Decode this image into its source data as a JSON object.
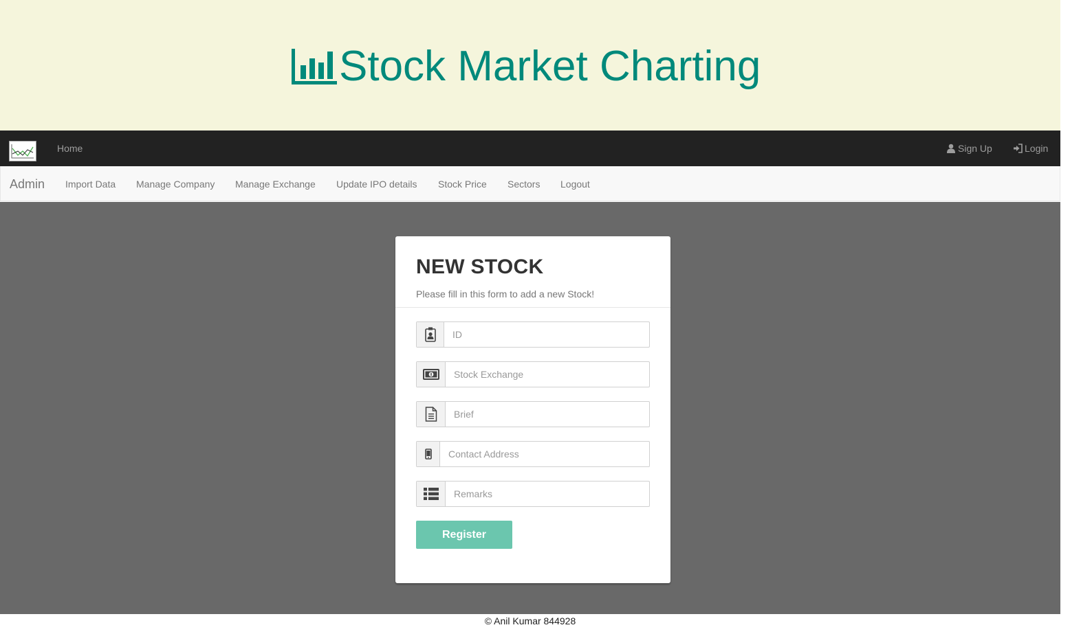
{
  "banner": {
    "title": "Stock Market Charting",
    "icon": "bar-chart-icon",
    "color": "#00897b"
  },
  "topnav": {
    "logo": "stock-chart-logo",
    "home": "Home",
    "signup": "Sign Up",
    "login": "Login"
  },
  "adminnav": {
    "brand": "Admin",
    "items": [
      "Import Data",
      "Manage Company",
      "Manage Exchange",
      "Update IPO details",
      "Stock Price",
      "Sectors",
      "Logout"
    ]
  },
  "form": {
    "title": "NEW STOCK",
    "subtitle": "Please fill in this form to add a new Stock!",
    "fields": [
      {
        "placeholder": "ID",
        "icon": "id-badge-icon"
      },
      {
        "placeholder": "Stock Exchange",
        "icon": "money-bill-icon"
      },
      {
        "placeholder": "Brief",
        "icon": "document-icon"
      },
      {
        "placeholder": "Contact Address",
        "icon": "mobile-phone-icon"
      },
      {
        "placeholder": "Remarks",
        "icon": "list-icon"
      }
    ],
    "submit_label": "Register",
    "submit_color": "#6bc6ae"
  },
  "footer": {
    "text": "© Anil Kumar 844928"
  }
}
